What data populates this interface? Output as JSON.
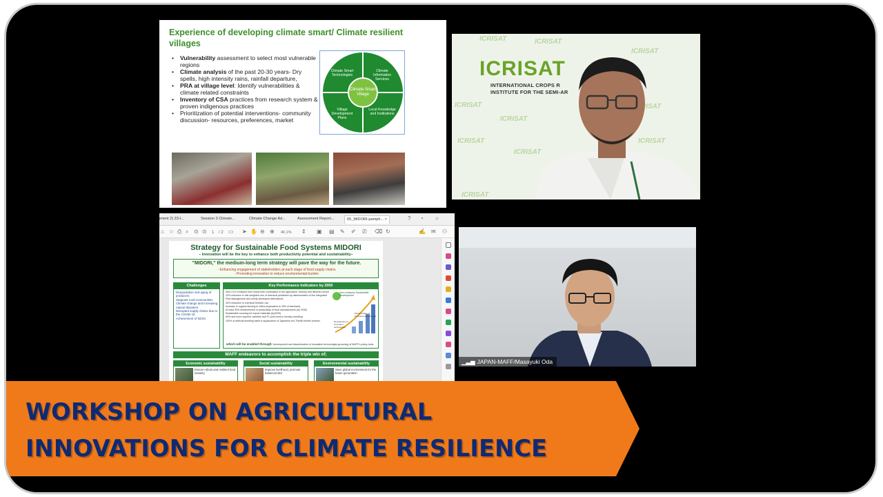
{
  "slide": {
    "title": "Experience of developing climate smart/ Climate resilient villages",
    "bullets": [
      {
        "bold": "Vulnerability",
        "text": " assessment to select most vulnerable regions"
      },
      {
        "bold": "Climate analysis",
        "text": " of the past 20-30 years- Dry spells, high intensity rains, rainfall departure,"
      },
      {
        "bold": "PRA at village level",
        "text": ": Identify vulnerabilities & climate related constraints"
      },
      {
        "bold": "Inventory of CSA",
        "text": " practices from research system & proven indigenous practices"
      },
      {
        "bold": "",
        "text": "Prioritization of potential interventions- community discussion- resources, preferences, market"
      }
    ],
    "diagram": {
      "q1": "Climate Smart Technologies",
      "q2": "Climate Information Services",
      "q3": "Village Development Plans",
      "q4": "Local Knowledge and Institutions",
      "center": "Climate Smart Village"
    }
  },
  "icrisat": {
    "logo": "ICRISAT",
    "line1": "INTERNATIONAL CROPS R",
    "line2": "INSTITUTE FOR THE SEMI-AR",
    "watermark": "ICRISAT"
  },
  "pdf": {
    "tabs": [
      "hment 2) 23-I...",
      "Session 3 Climate...",
      "Climate Change Ad...",
      "Assessment Report...",
      "05_MIDORI-pamph..."
    ],
    "page_current": "1",
    "page_total": "/ 2",
    "zoom": "40.1%",
    "doc": {
      "title": "Strategy for Sustainable Food Systems MIDORI",
      "subtitle": "– Innovation will be the key to enhance both productivity potential and sustainability–",
      "band_head": "\"MIDORI,\" the medium-long term strategy will pave the way for the future.",
      "band_s1": "- Enhancing engagement of stakeholders at each stage of food supply chains",
      "band_s2": "- Promoting innovation to reduce environmental burden",
      "challenges_head": "Challenges",
      "challenges": [
        "Depopulation and aging of producers",
        "Stagnant rural communities",
        "Climate change and increasing natural disasters",
        "Disrupted supply chains due to the COVID-19",
        "Achievement of SDGs"
      ],
      "kpi_head": "Key Performance Indicators by 2050",
      "kpis": [
        "Zero CO2 emission from fossil fuels combustion in the agriculture, forestry and fisheries sector",
        "10% reduction in risk-weighted use of chemical pesticides by dissemination of the Integrated Pest Management and newly-developed alternatives",
        "30% reduction in chemical fertilizer use",
        "Increase in organic farming to 1Mha (equivalent to 25% of farmland)",
        "At least 30% enhancement in productivity of food manufacturers (by 2030)",
        "Sustainable sourcing for import materials (by2030)",
        "90% and more superior varieties and F1 plus trees in forestry seedling",
        "100% of artificial seedling rates in aquaculture of Japanese eel, Pacific bluefin tuneetc."
      ],
      "kpi_chart_label": "Zero-emission Sustainable Development",
      "kpi_chart_note1": "Dissemination of innovative technologies",
      "kpi_chart_note2": "Development of innovative technologies",
      "kpi_foot_l": "which will be enabled through:",
      "kpi_foot_r": "development and dissemination of innovative technologies grooming of MAFF's policy tools",
      "maff_band": "MAFF endeavors to accomplish the triple win of;",
      "triple": [
        {
          "head": "Economic sustainability",
          "text": "Ensure robust and resilient food industry"
        },
        {
          "head": "Social sustainability",
          "text": "Improve livelihood, promote balanced diet"
        },
        {
          "head": "Environmental sustainability",
          "text": "Save global environment for the future generation"
        }
      ]
    }
  },
  "maff": {
    "name": "JAPAN-MAFF/Masayuki Oda"
  },
  "banner": {
    "line1": "WORKSHOP ON AGRICULTURAL",
    "line2": "INNOVATIONS FOR CLIMATE RESILIENCE",
    "color": "#f07a1a",
    "text_color": "#0e2a73"
  }
}
